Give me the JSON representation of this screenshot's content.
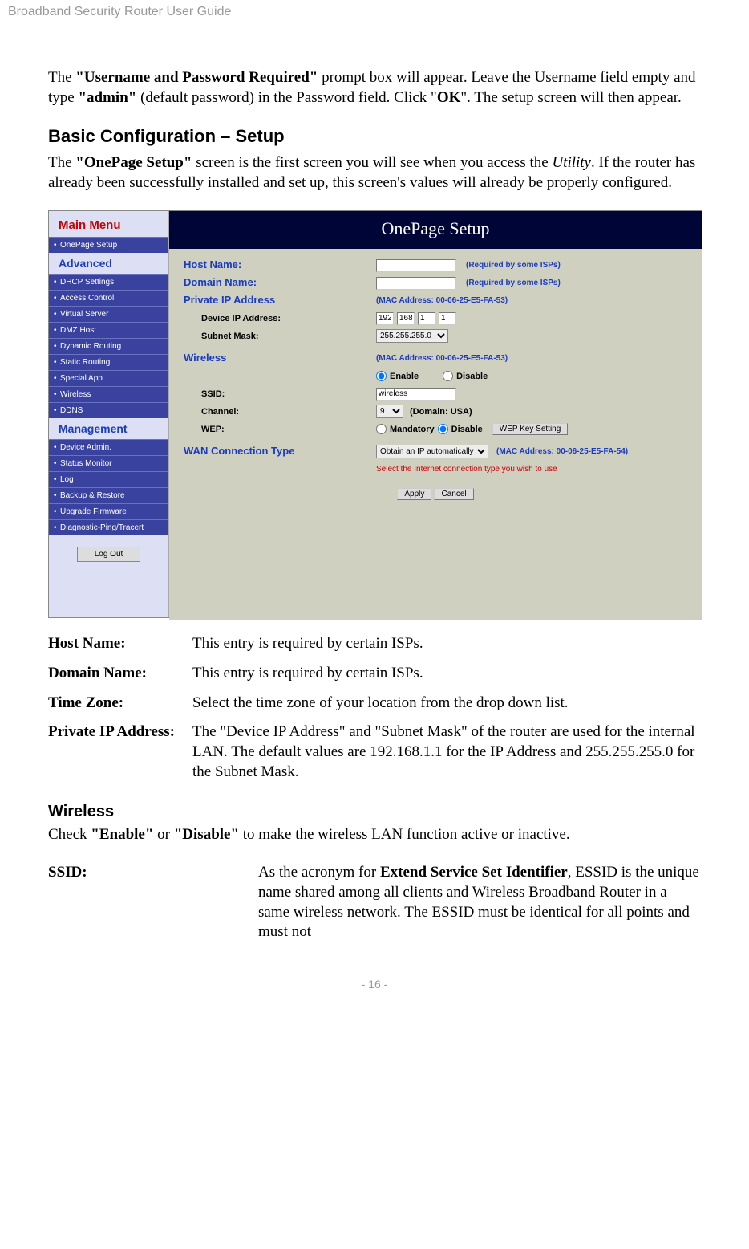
{
  "header": "Broadband Security Router User Guide",
  "intro": {
    "t1": "The ",
    "b1": "\"Username and Password Required\"",
    "t2": " prompt box will appear. Leave the Username field empty and type ",
    "b2": "\"admin\"",
    "t3": " (default password) in the Password field. Click \"",
    "b3": "OK",
    "t4": "\". The setup screen will then appear."
  },
  "section1": {
    "title": "Basic Configuration – Setup",
    "t1": "The ",
    "b1": "\"OnePage Setup\"",
    "t2": " screen is the first screen you will see when you access the ",
    "i1": "Utility",
    "t3": ". If the router has already been successfully installed and set up, this screen's values will already be properly configured."
  },
  "screenshot": {
    "main_menu": "Main Menu",
    "onepage_item": "OnePage Setup",
    "advanced": "Advanced",
    "adv_items": [
      "DHCP Settings",
      "Access Control",
      "Virtual Server",
      "DMZ Host",
      "Dynamic Routing",
      "Static Routing",
      "Special App",
      "Wireless",
      "DDNS"
    ],
    "management": "Management",
    "mgmt_items": [
      "Device Admin.",
      "Status Monitor",
      "Log",
      "Backup & Restore",
      "Upgrade Firmware",
      "Diagnostic-Ping/Tracert"
    ],
    "logout": "Log Out",
    "banner": "OnePage Setup",
    "host_name": "Host Name:",
    "domain_name": "Domain Name:",
    "private_ip": "Private IP Address",
    "device_ip": "Device IP Address:",
    "subnet": "Subnet Mask:",
    "wireless": "Wireless",
    "ssid": "SSID:",
    "channel": "Channel:",
    "wep": "WEP:",
    "wan": "WAN Connection Type",
    "required_note": "(Required by some ISPs)",
    "mac1": "(MAC Address: 00-06-25-E5-FA-53)",
    "mac2": "(MAC Address: 00-06-25-E5-FA-53)",
    "mac3": "(MAC Address: 00-06-25-E5-FA-54)",
    "ip": {
      "a": "192",
      "b": "168",
      "c": "1",
      "d": "1"
    },
    "subnet_val": "255.255.255.0",
    "enable": "Enable",
    "disable": "Disable",
    "ssid_val": "wireless",
    "channel_val": "9",
    "domain_usa": "(Domain: USA)",
    "mandatory": "Mandatory",
    "wep_key": "WEP Key Setting",
    "wan_val": "Obtain an IP automatically",
    "select_type": "Select the Internet connection type you wish to use",
    "apply": "Apply",
    "cancel": "Cancel"
  },
  "defs": [
    {
      "label": "Host Name:",
      "text": "This entry is required by certain ISPs."
    },
    {
      "label": "Domain Name:",
      "text": "This entry is required by certain ISPs."
    },
    {
      "label": "Time Zone:",
      "text": "Select the time zone of your location from the drop down list."
    },
    {
      "label": "Private IP Address:",
      "text": "The \"Device IP Address\" and \"Subnet Mask\" of the router are used for the internal LAN. The default values are 192.168.1.1 for the IP Address and 255.255.255.0 for the Subnet Mask."
    }
  ],
  "wireless_section": {
    "title": "Wireless",
    "t1": "Check ",
    "b1": "\"Enable\"",
    "t2": " or ",
    "b2": "\"Disable\"",
    "t3": " to make the wireless LAN function active or inactive.",
    "ssid_label": "SSID:",
    "ssid_t1": "As the acronym for ",
    "ssid_b1": "Extend Service Set Identifier",
    "ssid_t2": ", ESSID is the unique name shared among all clients and Wireless Broadband Router in a same wireless network. The ESSID must be identical for all points and must not"
  },
  "footer": "- 16 -"
}
